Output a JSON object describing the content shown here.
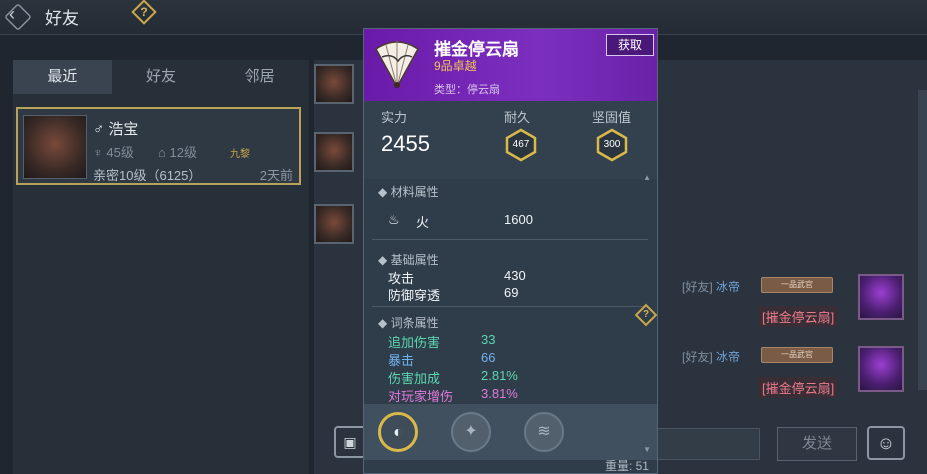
{
  "header": {
    "title": "好友",
    "help": "?"
  },
  "tabs": [
    {
      "label": "最近"
    },
    {
      "label": "好友"
    },
    {
      "label": "邻居"
    }
  ],
  "friend": {
    "gender": "♂",
    "name": "浩宝",
    "level": "45级",
    "house_level": "12级",
    "job": "九黎",
    "intimacy": "亲密10级（6125）",
    "time": "2天前"
  },
  "messages": [
    {
      "prefix": "[好友]",
      "sender": "冰帝",
      "chip": "一品武官",
      "item": "[摧金停云扇]"
    },
    {
      "prefix": "[好友]",
      "sender": "冰帝",
      "chip": "一品武官",
      "item": "[摧金停云扇]"
    }
  ],
  "chat": {
    "send_label": "发送",
    "input_placeholder": ""
  },
  "tooltip": {
    "name": "摧金停云扇",
    "grade": "9品卓越",
    "type": "类型：停云扇",
    "get_button": "获取",
    "stats": {
      "power_label": "实力",
      "power": "2455",
      "durability_label": "耐久",
      "durability": "467",
      "firmness_label": "坚固值",
      "firmness": "300"
    },
    "material": {
      "title": "材料属性",
      "element": "火",
      "value": "1600"
    },
    "base": {
      "title": "基础属性",
      "rows": [
        {
          "label": "攻击",
          "value": "430"
        },
        {
          "label": "防御穿透",
          "value": "69"
        }
      ]
    },
    "affix": {
      "title": "词条属性",
      "rows": [
        {
          "label": "追加伤害",
          "value": "33",
          "color": "#5ed6b0"
        },
        {
          "label": "暴击",
          "value": "66",
          "color": "#6fb2ee"
        },
        {
          "label": "伤害加成",
          "value": "2.81%",
          "color": "#5ed6b0"
        },
        {
          "label": "对玩家增伤",
          "value": "3.81%",
          "color": "#e279d9"
        }
      ]
    },
    "weight": "重量: 51"
  }
}
